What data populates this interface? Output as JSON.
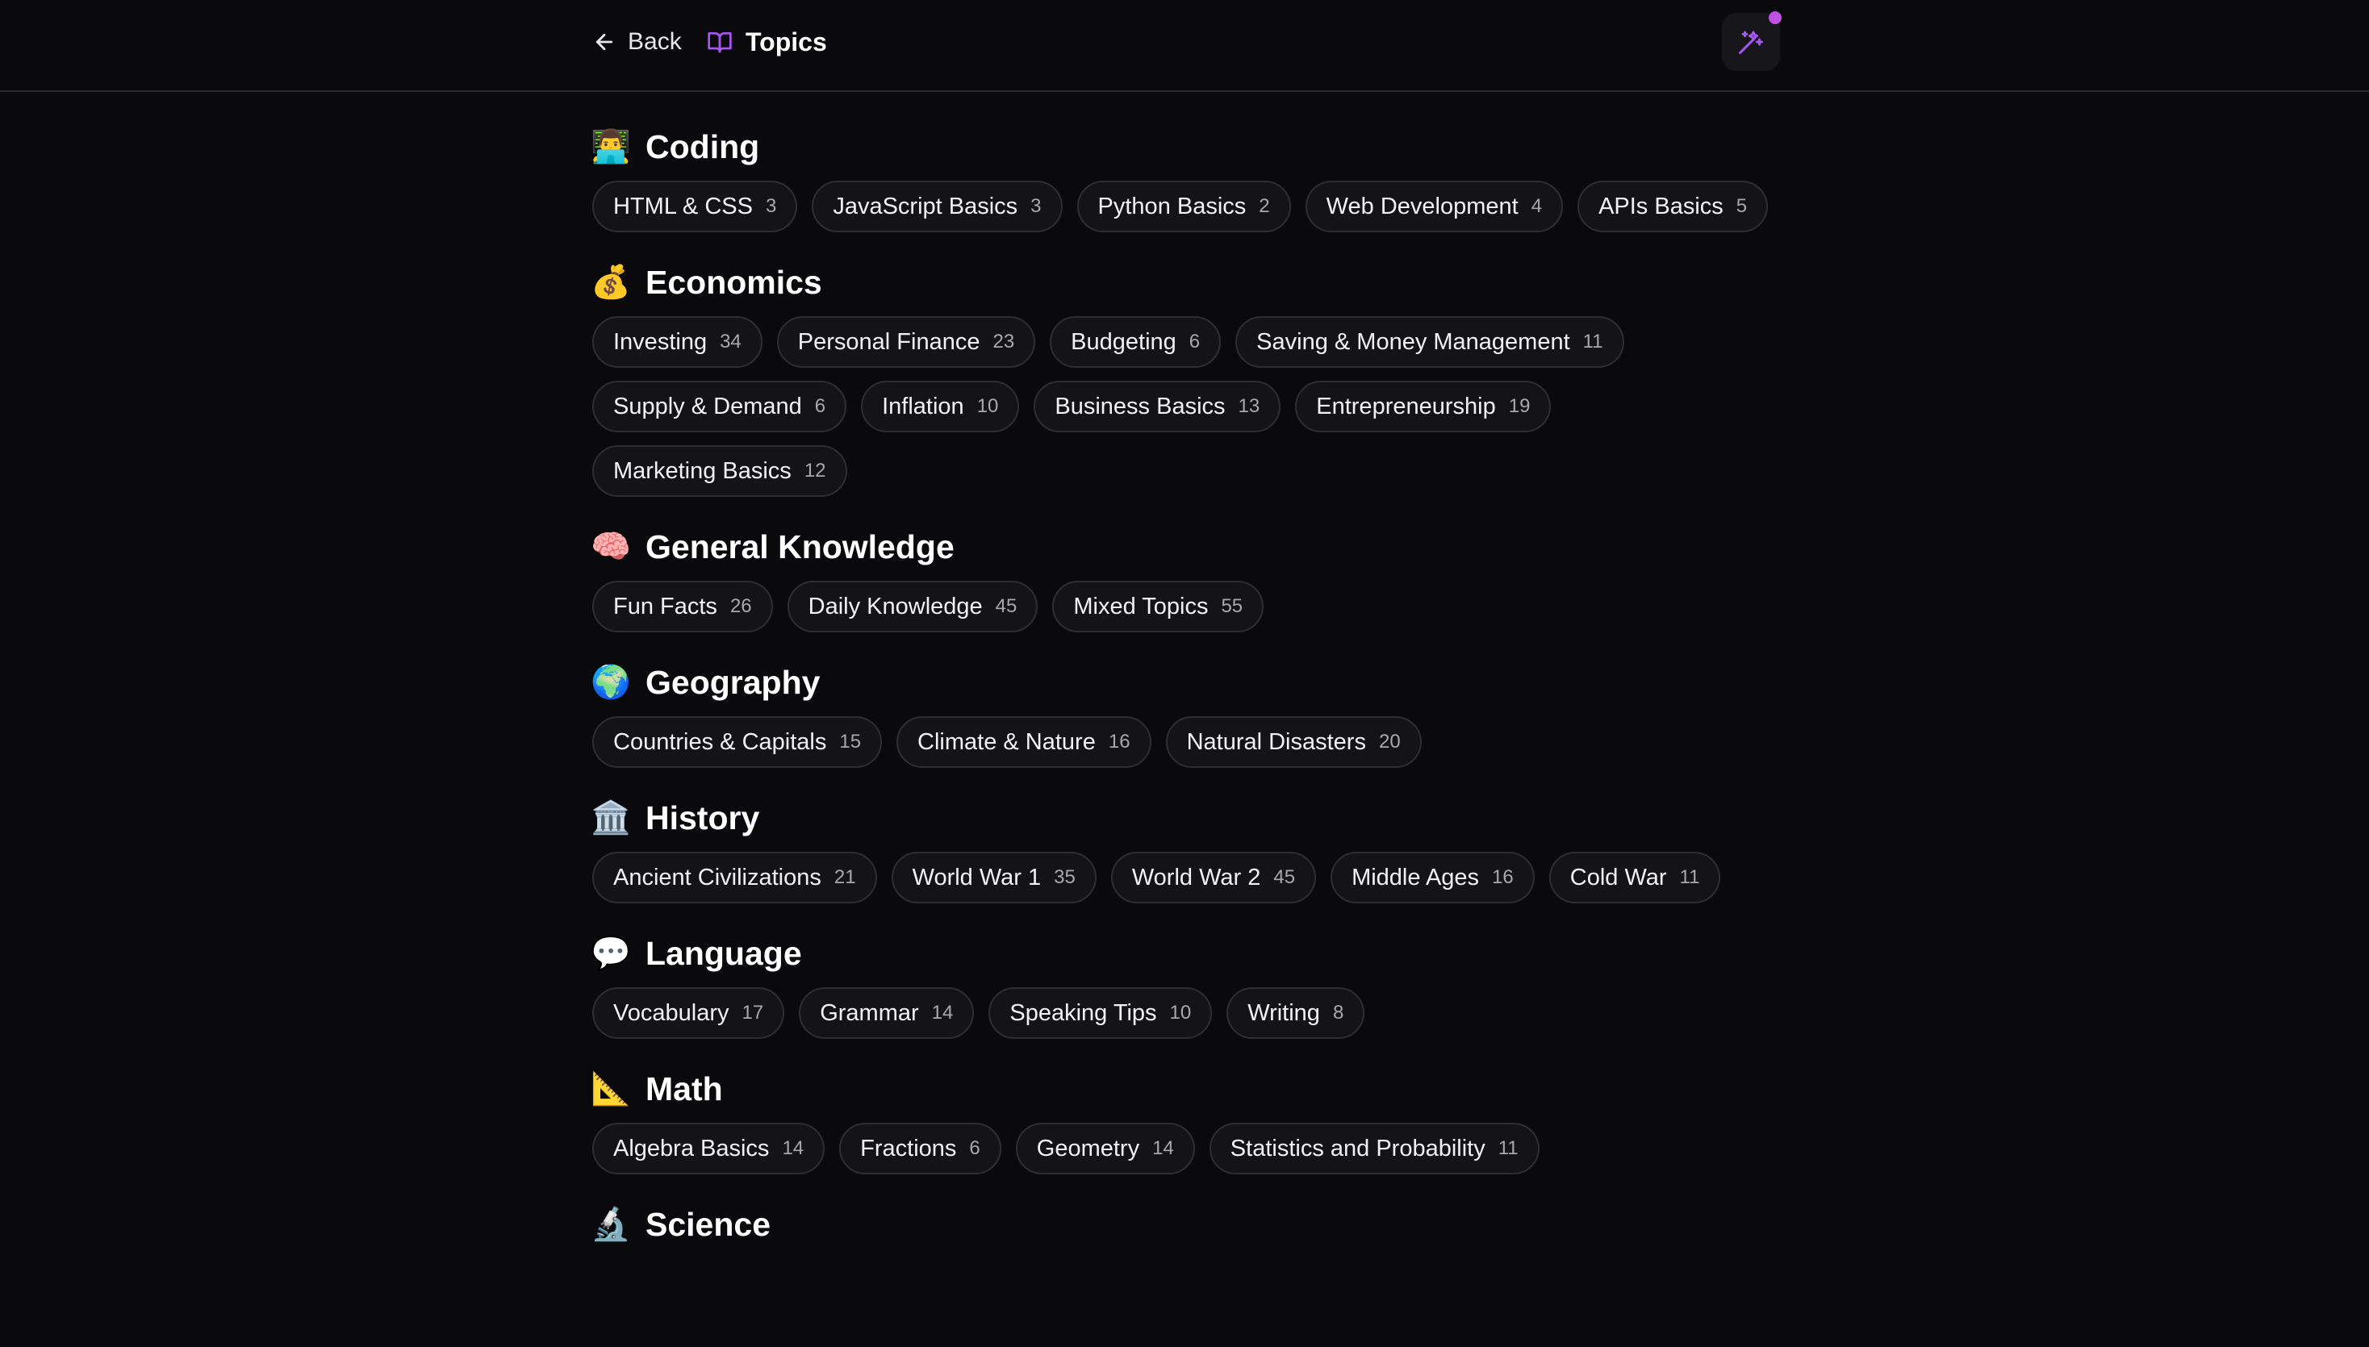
{
  "header": {
    "back_label": "Back",
    "title": "Topics",
    "accent_color": "#a855f7",
    "notification_color": "#c050e0"
  },
  "sections": [
    {
      "name": "coding",
      "emoji": "👨‍💻",
      "title": "Coding",
      "topics": [
        {
          "label": "HTML & CSS",
          "count": "3"
        },
        {
          "label": "JavaScript Basics",
          "count": "3"
        },
        {
          "label": "Python Basics",
          "count": "2"
        },
        {
          "label": "Web Development",
          "count": "4"
        },
        {
          "label": "APIs Basics",
          "count": "5"
        }
      ]
    },
    {
      "name": "economics",
      "emoji": "💰",
      "title": "Economics",
      "topics": [
        {
          "label": "Investing",
          "count": "34"
        },
        {
          "label": "Personal Finance",
          "count": "23"
        },
        {
          "label": "Budgeting",
          "count": "6"
        },
        {
          "label": "Saving & Money Management",
          "count": "11"
        },
        {
          "label": "Supply & Demand",
          "count": "6"
        },
        {
          "label": "Inflation",
          "count": "10"
        },
        {
          "label": "Business Basics",
          "count": "13"
        },
        {
          "label": "Entrepreneurship",
          "count": "19"
        },
        {
          "label": "Marketing Basics",
          "count": "12"
        }
      ]
    },
    {
      "name": "general-knowledge",
      "emoji": "🧠",
      "title": "General Knowledge",
      "topics": [
        {
          "label": "Fun Facts",
          "count": "26"
        },
        {
          "label": "Daily Knowledge",
          "count": "45"
        },
        {
          "label": "Mixed Topics",
          "count": "55"
        }
      ]
    },
    {
      "name": "geography",
      "emoji": "🌍",
      "title": "Geography",
      "topics": [
        {
          "label": "Countries & Capitals",
          "count": "15"
        },
        {
          "label": "Climate & Nature",
          "count": "16"
        },
        {
          "label": "Natural Disasters",
          "count": "20"
        }
      ]
    },
    {
      "name": "history",
      "emoji": "🏛️",
      "title": "History",
      "topics": [
        {
          "label": "Ancient Civilizations",
          "count": "21"
        },
        {
          "label": "World War 1",
          "count": "35"
        },
        {
          "label": "World War 2",
          "count": "45"
        },
        {
          "label": "Middle Ages",
          "count": "16"
        },
        {
          "label": "Cold War",
          "count": "11"
        }
      ]
    },
    {
      "name": "language",
      "emoji": "💬",
      "title": "Language",
      "topics": [
        {
          "label": "Vocabulary",
          "count": "17"
        },
        {
          "label": "Grammar",
          "count": "14"
        },
        {
          "label": "Speaking Tips",
          "count": "10"
        },
        {
          "label": "Writing",
          "count": "8"
        }
      ]
    },
    {
      "name": "math",
      "emoji": "📐",
      "title": "Math",
      "topics": [
        {
          "label": "Algebra Basics",
          "count": "14"
        },
        {
          "label": "Fractions",
          "count": "6"
        },
        {
          "label": "Geometry",
          "count": "14"
        },
        {
          "label": "Statistics and Probability",
          "count": "11"
        }
      ]
    },
    {
      "name": "science",
      "emoji": "🔬",
      "title": "Science",
      "topics": []
    }
  ]
}
